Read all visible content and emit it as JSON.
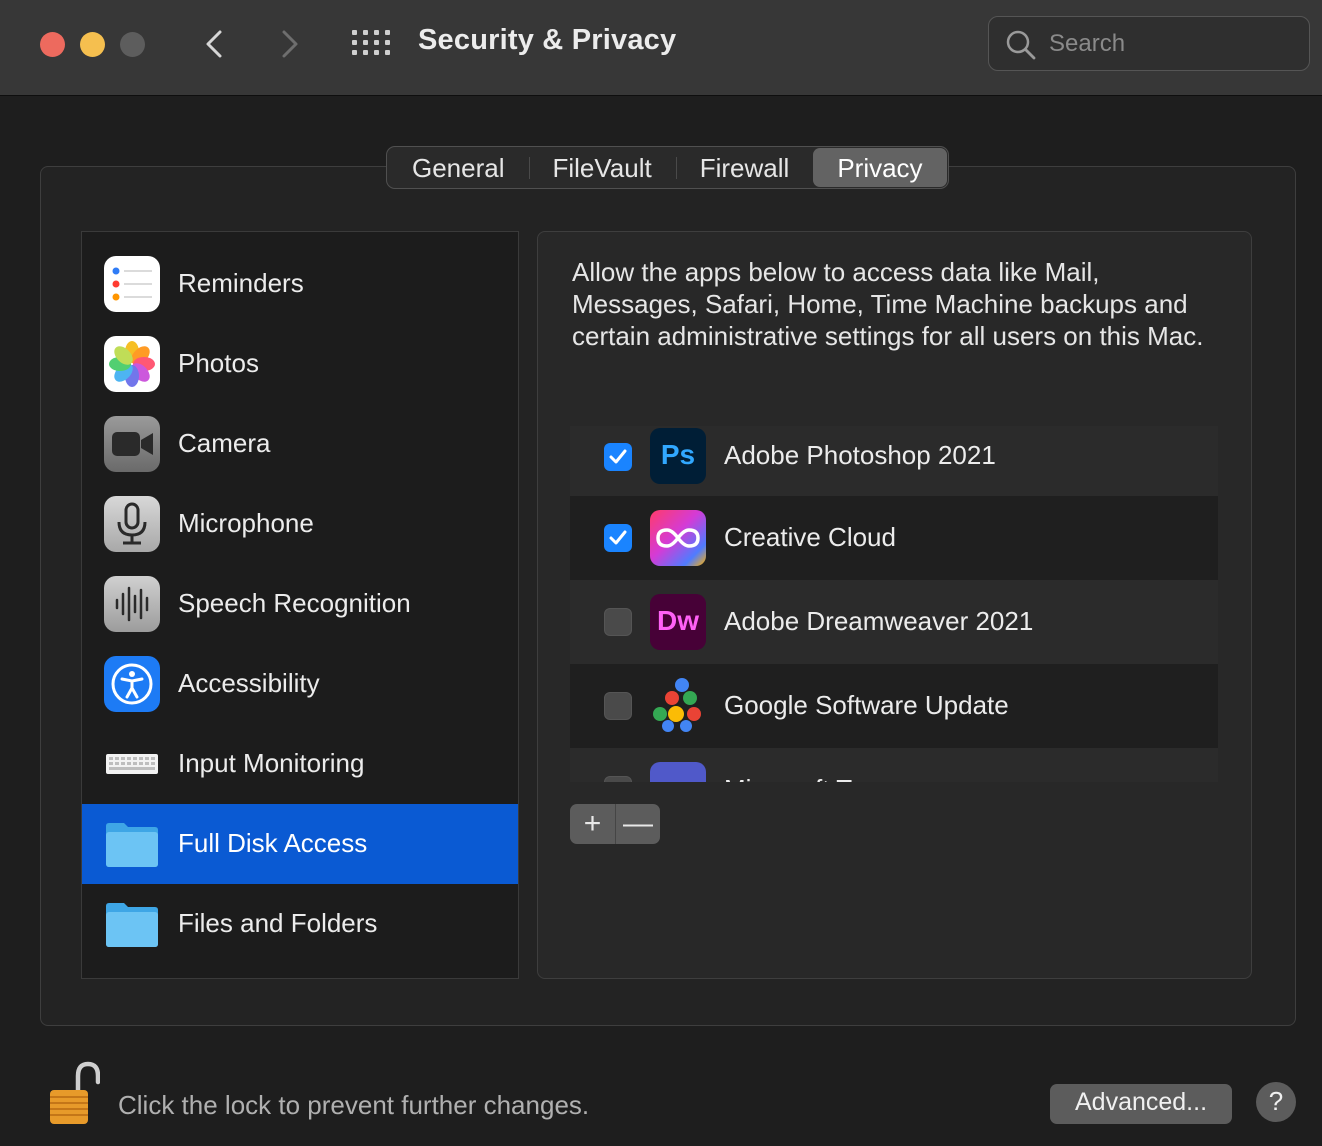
{
  "window": {
    "title": "Security & Privacy",
    "search_placeholder": "Search"
  },
  "tabs": [
    {
      "label": "General",
      "active": false
    },
    {
      "label": "FileVault",
      "active": false
    },
    {
      "label": "Firewall",
      "active": false
    },
    {
      "label": "Privacy",
      "active": true
    }
  ],
  "sidebar": {
    "items": [
      {
        "label": "Reminders",
        "icon": "reminders-icon"
      },
      {
        "label": "Photos",
        "icon": "photos-icon"
      },
      {
        "label": "Camera",
        "icon": "camera-icon"
      },
      {
        "label": "Microphone",
        "icon": "microphone-icon"
      },
      {
        "label": "Speech Recognition",
        "icon": "speech-recognition-icon"
      },
      {
        "label": "Accessibility",
        "icon": "accessibility-icon"
      },
      {
        "label": "Input Monitoring",
        "icon": "keyboard-icon"
      },
      {
        "label": "Full Disk Access",
        "icon": "folder-icon",
        "selected": true
      },
      {
        "label": "Files and Folders",
        "icon": "folder-icon"
      }
    ]
  },
  "privacy": {
    "description": "Allow the apps below to access data like Mail, Messages, Safari, Home, Time Machine backups and certain administrative settings for all users on this Mac.",
    "apps": [
      {
        "name": "Adobe Photoshop 2021",
        "checked": true,
        "icon": "photoshop-icon",
        "icon_text": "Ps"
      },
      {
        "name": "Creative Cloud",
        "checked": true,
        "icon": "creative-cloud-icon"
      },
      {
        "name": "Adobe Dreamweaver 2021",
        "checked": false,
        "icon": "dreamweaver-icon",
        "icon_text": "Dw"
      },
      {
        "name": "Google Software Update",
        "checked": false,
        "icon": "google-software-update-icon"
      },
      {
        "name": "Microsoft Teams",
        "checked": false,
        "icon": "teams-icon"
      }
    ],
    "add_label": "+",
    "remove_label": "—"
  },
  "footer": {
    "lock_text": "Click the lock to prevent further changes.",
    "advanced_label": "Advanced...",
    "help_label": "?"
  },
  "colors": {
    "selection": "#0a5ad3",
    "checkbox_on": "#1a84ff",
    "close": "#ed6a5e",
    "minimize": "#f5bf4f"
  }
}
